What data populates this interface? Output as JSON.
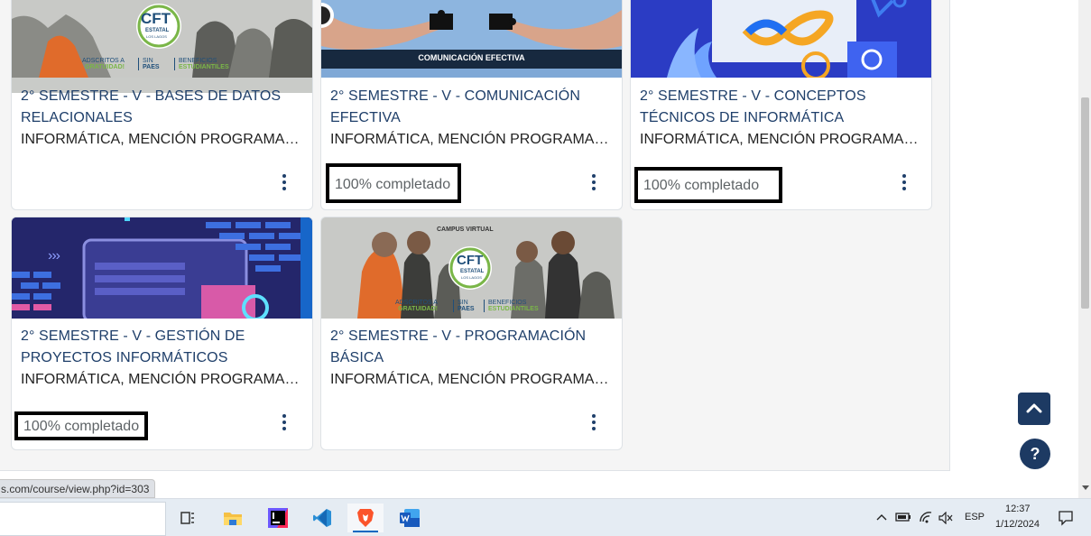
{
  "colors": {
    "title": "#1f3f6a",
    "accent_navy": "#1d3a63",
    "page_bg": "#f5f5f5"
  },
  "courses": [
    {
      "title": "2° SEMESTRE - V - BASES DE DATOS RELACIONALES",
      "category": "INFORMÁTICA, MENCIÓN PROGRAMACIÓN",
      "progress_label": "",
      "menu_icon": "kebab-icon",
      "image": {
        "badge": "CFT",
        "badge_sub": "ESTATAL",
        "badge_sub2": "LOS LAGOS",
        "footer_1a": "ADSCRITOS A",
        "footer_1b": "GRATUIDAD!",
        "footer_2a": "SIN",
        "footer_2b": "PAES",
        "footer_3a": "BENEFICIOS",
        "footer_3b": "ESTUDIANTILES"
      }
    },
    {
      "title": "2° SEMESTRE - V - COMUNICACIÓN EFECTIVA",
      "category": "INFORMÁTICA, MENCIÓN PROGRAMACIÓN",
      "progress_label": "100% completado",
      "menu_icon": "kebab-icon",
      "image": {
        "banner": "COMUNICACIÓN EFECTIVA"
      }
    },
    {
      "title": "2° SEMESTRE - V - CONCEPTOS TÉCNICOS DE INFORMÁTICA",
      "category": "INFORMÁTICA, MENCIÓN PROGRAMACIÓN",
      "progress_label": "100% completado",
      "menu_icon": "kebab-icon"
    },
    {
      "title": "2° SEMESTRE - V - GESTIÓN DE PROYECTOS INFORMÁTICOS",
      "category": "INFORMÁTICA, MENCIÓN PROGRAMACIÓN",
      "progress_label": "100% completado",
      "menu_icon": "kebab-icon",
      "image": {
        "arrows": "›››"
      }
    },
    {
      "title": "2° SEMESTRE - V - PROGRAMACIÓN BÁSICA",
      "category": "INFORMÁTICA, MENCIÓN PROGRAMACIÓN",
      "progress_label": "",
      "menu_icon": "kebab-icon",
      "image": {
        "header": "CAMPUS VIRTUAL",
        "badge": "CFT",
        "badge_sub": "ESTATAL",
        "badge_sub2": "LOS LAGOS",
        "footer_1a": "ADSCRITOS A",
        "footer_1b": "GRATUIDAD!",
        "footer_2a": "SIN",
        "footer_2b": "PAES",
        "footer_3a": "BENEFICIOS",
        "footer_3b": "ESTUDIANTILES"
      }
    }
  ],
  "floating": {
    "back_to_top_icon": "chevron-up-icon",
    "help_label": "?"
  },
  "status_bar": {
    "url": "s.com/course/view.php?id=303"
  },
  "taskbar": {
    "apps": [
      "task-view-icon",
      "file-explorer-icon",
      "intellij-icon",
      "vscode-icon",
      "brave-icon",
      "word-icon"
    ],
    "tray": {
      "language": "ESP",
      "time": "12:37",
      "date": "1/12/2024"
    }
  }
}
